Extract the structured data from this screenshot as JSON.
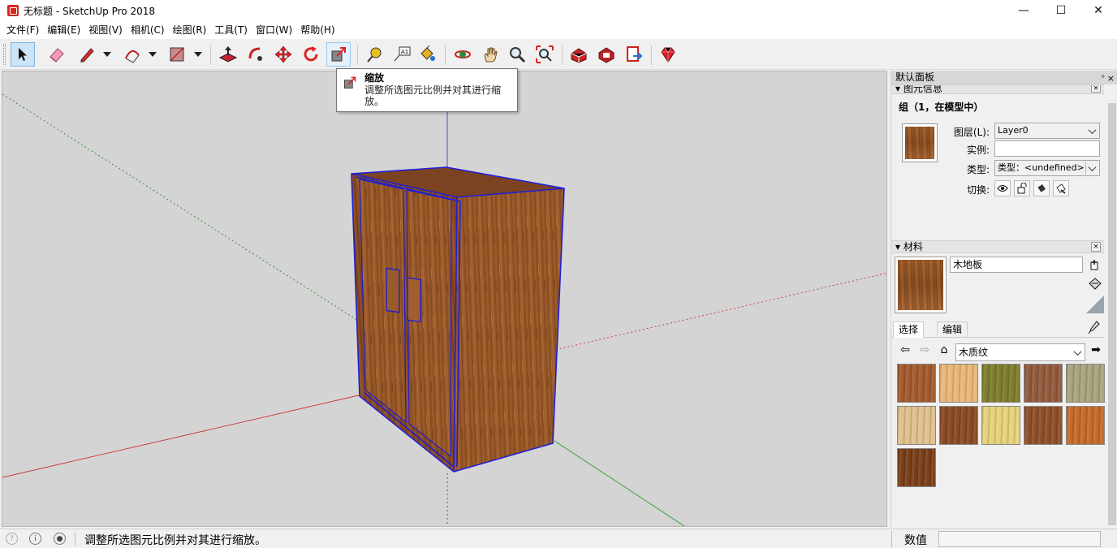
{
  "window": {
    "title": "无标题 - SketchUp Pro 2018",
    "minimize": "—",
    "maximize": "☐",
    "close": "✕"
  },
  "menu": [
    "文件(F)",
    "编辑(E)",
    "视图(V)",
    "相机(C)",
    "绘图(R)",
    "工具(T)",
    "窗口(W)",
    "帮助(H)"
  ],
  "tooltip": {
    "title": "缩放",
    "description": "调整所选图元比例并对其进行缩放。"
  },
  "tray": {
    "title": "默认面板",
    "pin": "ᵒ",
    "close": "×",
    "entity_panel": {
      "title": "图元信息",
      "entity_label": "组（1，在模型中）",
      "layer_label": "图层(L):",
      "layer_value": "Layer0",
      "instance_label": "实例:",
      "instance_value": "",
      "type_label": "类型:",
      "type_value": "类型：<undefined>",
      "toggle_label": "切换:"
    },
    "materials_panel": {
      "title": "材料",
      "material_name": "木地板",
      "tab_select": "选择",
      "tab_edit": "编辑",
      "library": "木质纹"
    }
  },
  "status": {
    "message": "调整所选图元比例并对其进行缩放。",
    "measurements_label": "数值"
  },
  "colors": {
    "selection_blue": "#1f1fd6",
    "wood_base": "#9b5a28",
    "viewport_bg": "#d4d4d4"
  },
  "swatches": [
    "#a35a2e",
    "#e8b778",
    "#7e7c2c",
    "#915a3d",
    "#a8a47e",
    "#e0c08c",
    "#8a4a22",
    "#e6d27a",
    "#8e4f27",
    "#c56a2a",
    "#7a3e1a"
  ]
}
